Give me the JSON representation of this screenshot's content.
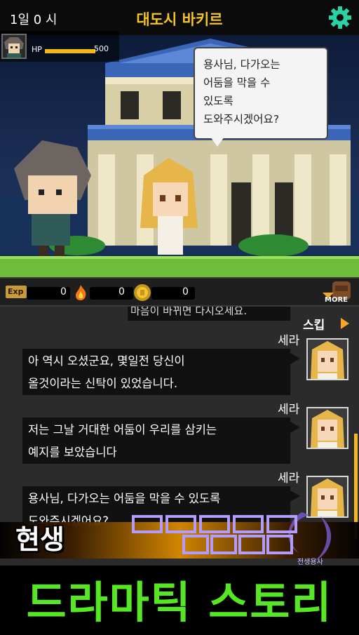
{
  "hud": {
    "day": "1일 0 시",
    "location": "대도시 바키르",
    "hp_label": "HP",
    "hp_value": "500",
    "hp_fraction": 1.0
  },
  "scene": {
    "speech": "용사님, 다가오는\n어둠을 막을 수\n있도록\n도와주시겠어요?"
  },
  "resources": {
    "exp_label": "Exp",
    "exp_value": "0",
    "fire_value": "0",
    "gold_value": "0",
    "more_label": "MORE"
  },
  "log": {
    "previous_line": "마음이 바뀌면 다시오세요.",
    "skip_label": "스킵",
    "entries": [
      {
        "speaker": "세라",
        "text": "아 역시 오셨군요, 몇일전 당신이\n올것이라는 신탁이 있었습니다."
      },
      {
        "speaker": "세라",
        "text": "저는 그날 거대한 어둠이 우리를 삼키는\n예지를 보았습니다"
      },
      {
        "speaker": "세라",
        "text": "용사님, 다가오는 어둠을 막을 수 있도록\n도와주시겠어요?"
      }
    ]
  },
  "promo": {
    "top_text": "현생",
    "logo_sub": "전생용사",
    "bottom_text": "드라마틱 스토리"
  },
  "colors": {
    "accent_gold": "#f5c623",
    "promo_green": "#57e624",
    "gear_teal": "#2ad3a6"
  }
}
